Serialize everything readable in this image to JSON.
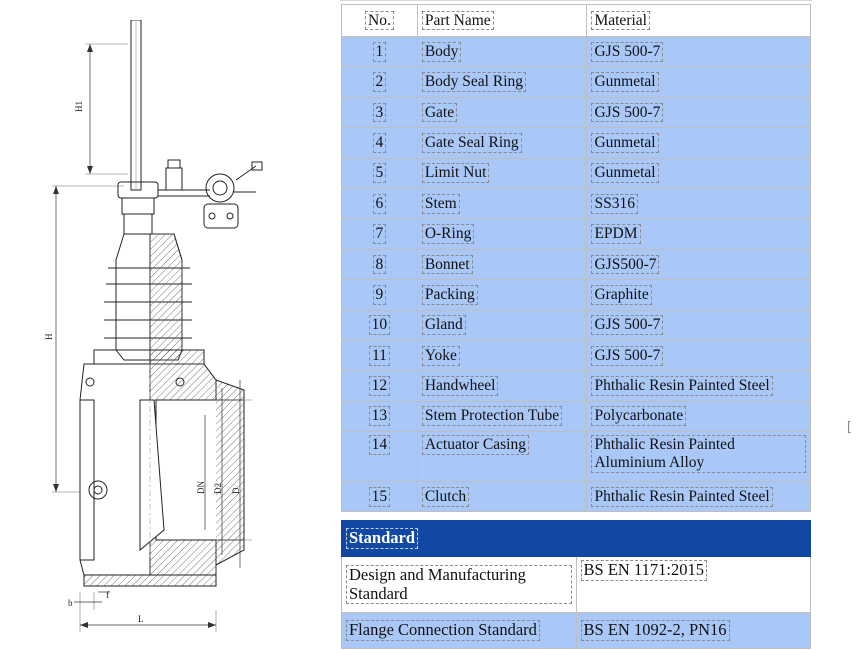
{
  "parts_table": {
    "headers": {
      "no": "No.",
      "part_name": "Part Name",
      "material": "Material"
    },
    "rows": [
      {
        "no": "1",
        "part_name": "Body",
        "material": "GJS 500-7"
      },
      {
        "no": "2",
        "part_name": "Body Seal Ring",
        "material": "Gunmetal"
      },
      {
        "no": "3",
        "part_name": "Gate",
        "material": "GJS 500-7"
      },
      {
        "no": "4",
        "part_name": "Gate Seal Ring",
        "material": "Gunmetal"
      },
      {
        "no": "5",
        "part_name": "Limit Nut",
        "material": "Gunmetal"
      },
      {
        "no": "6",
        "part_name": "Stem",
        "material": "SS316"
      },
      {
        "no": "7",
        "part_name": "O-Ring",
        "material": "EPDM"
      },
      {
        "no": "8",
        "part_name": "Bonnet",
        "material": "GJS500-7"
      },
      {
        "no": "9",
        "part_name": "Packing",
        "material": "Graphite"
      },
      {
        "no": "10",
        "part_name": "Gland",
        "material": "GJS 500-7"
      },
      {
        "no": "11",
        "part_name": "Yoke",
        "material": "GJS 500-7"
      },
      {
        "no": "12",
        "part_name": "Handwheel",
        "material": "Phthalic Resin Painted Steel"
      },
      {
        "no": "13",
        "part_name": "Stem Protection Tube",
        "material": "Polycarbonate"
      },
      {
        "no": "14",
        "part_name": "Actuator Casing",
        "material": "Phthalic Resin Painted Aluminium Alloy"
      },
      {
        "no": "15",
        "part_name": "Clutch",
        "material": "Phthalic Resin Painted Steel"
      }
    ]
  },
  "standard_table": {
    "title": "Standard",
    "rows": [
      {
        "label": "Design and Manufacturing Standard",
        "value": "BS EN 1171:2015"
      },
      {
        "label": "Flange Connection Standard",
        "value": "BS EN 1092-2, PN16"
      }
    ]
  },
  "drawing": {
    "dimension_labels": {
      "h1": "H1",
      "h": "H",
      "dn": "DN",
      "d2": "D2",
      "d": "D",
      "b": "b",
      "f": "f",
      "l": "L"
    }
  },
  "colors": {
    "row_blue": "#a9c8f7",
    "standard_header": "#1048a4",
    "border": "#bfbfbf"
  }
}
